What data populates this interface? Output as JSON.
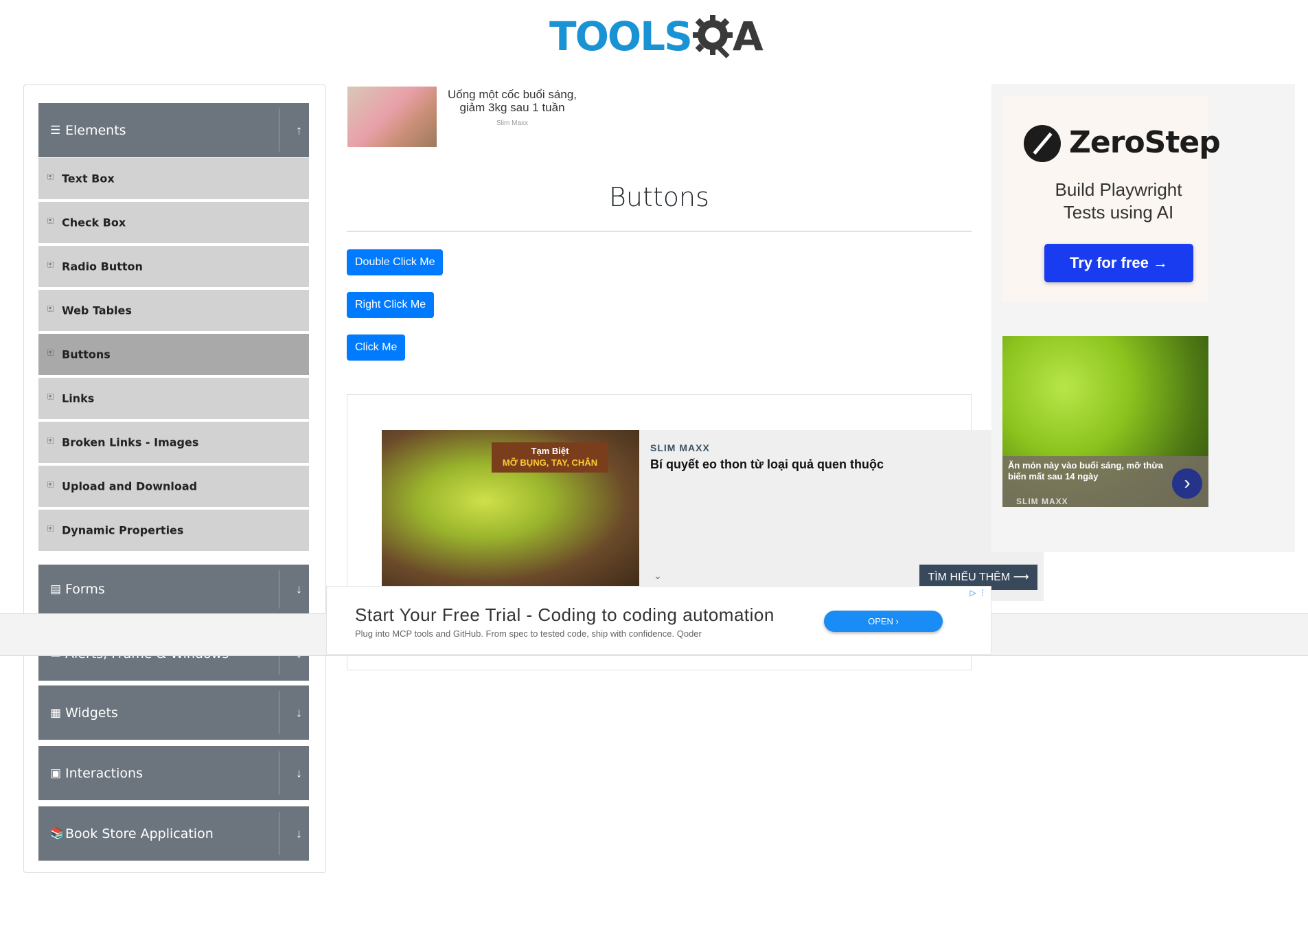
{
  "header": {
    "logo_text_left": "TOOLS",
    "logo_text_right": "A"
  },
  "sidebar": {
    "groups": [
      {
        "label": "Elements",
        "icon": "menu-icon",
        "arrow": "↑",
        "expanded": true
      },
      {
        "label": "Forms",
        "icon": "form-icon",
        "arrow": "↓"
      },
      {
        "label": "Alerts, Frame & Windows",
        "icon": "window-icon",
        "arrow": "↓"
      },
      {
        "label": "Widgets",
        "icon": "widgets-icon",
        "arrow": "↓"
      },
      {
        "label": "Interactions",
        "icon": "interactions-icon",
        "arrow": "↓"
      },
      {
        "label": "Book Store Application",
        "icon": "book-icon",
        "arrow": "↓"
      }
    ],
    "items": [
      {
        "label": "Text Box",
        "icon": "html5-icon"
      },
      {
        "label": "Check Box",
        "icon": "html5-icon"
      },
      {
        "label": "Radio Button",
        "icon": "html5-icon"
      },
      {
        "label": "Web Tables",
        "icon": "html5-icon"
      },
      {
        "label": "Buttons",
        "icon": "html5-icon",
        "active": true
      },
      {
        "label": "Links",
        "icon": "html5-icon"
      },
      {
        "label": "Broken Links - Images",
        "icon": "html5-icon"
      },
      {
        "label": "Upload and Download",
        "icon": "html5-icon"
      },
      {
        "label": "Dynamic Properties",
        "icon": "html5-icon"
      }
    ]
  },
  "top_ad": {
    "text_line1": "Uống một cốc buổi sáng,",
    "text_line2": "giảm 3kg sau 1 tuần",
    "source": "Slim Maxx"
  },
  "main": {
    "title": "Buttons",
    "buttons": {
      "double_click": "Double Click Me",
      "right_click": "Right Click Me",
      "click": "Click Me"
    }
  },
  "banana_ad": {
    "tag_line1": "Tạm Biệt",
    "tag_line2": "MỠ BỤNG, TAY, CHÂN",
    "brand": "SLIM MAXX",
    "headline": "Bí quyết eo thon từ loại quả quen thuộc",
    "cta": "TÌM HIỂU THÊM ⟶",
    "chevron": "⌄"
  },
  "bottom_ad": {
    "headline": "Start Your Free Trial - Coding to coding automation",
    "sub": "Plug into MCP tools and GitHub. From spec to tested code, ship with confidence. Qoder",
    "open": "OPEN ›",
    "ad_icon": "▷ ⋮"
  },
  "zerostep_ad": {
    "name": "ZeroStep",
    "tagline_line1": "Build Playwright",
    "tagline_line2": "Tests using AI",
    "cta": "Try for free →"
  },
  "jelly_ad": {
    "text": "Ăn món này vào buổi sáng, mỡ thừa biến mất sau 14 ngày",
    "brand": "SLIM MAXX",
    "go": "›"
  },
  "colors": {
    "primary_button": "#007bff",
    "sidebar_header": "#6c757d",
    "menu_item": "#d2d2d2",
    "menu_active": "#a9a9a9",
    "logo_blue": "#1a93d4"
  }
}
